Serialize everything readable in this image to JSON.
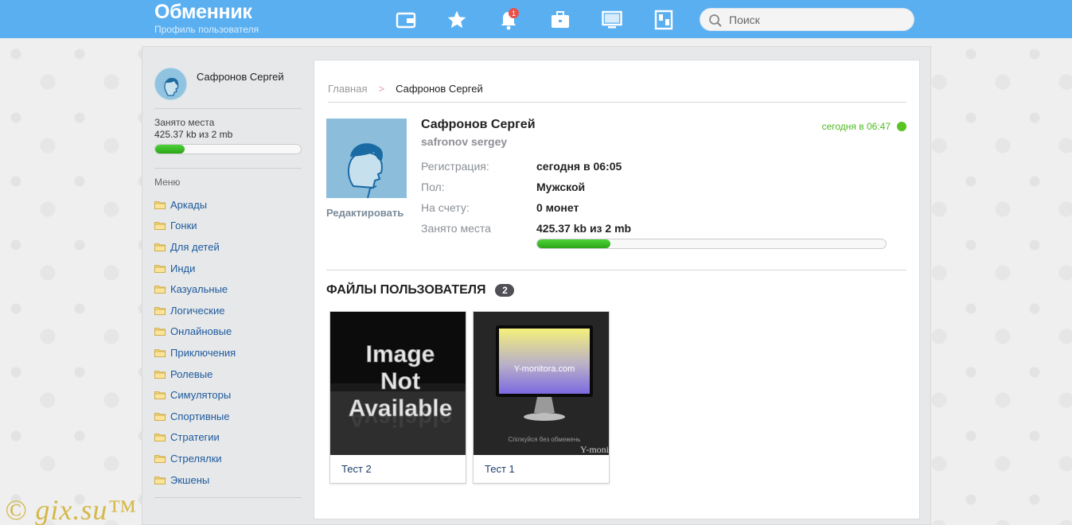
{
  "header": {
    "title": "Обменник",
    "subtitle": "Профиль пользователя",
    "nav_icons": [
      "wallet-icon",
      "star-icon",
      "bell-icon",
      "briefcase-icon",
      "monitor-icon",
      "device-icon"
    ],
    "notification_count": "1",
    "search_placeholder": "Поиск"
  },
  "sidebar": {
    "user_name": "Сафронов Сергей",
    "storage_label": "Занято места",
    "storage_value": "425.37 kb из 2 mb",
    "storage_fraction": 0.2,
    "menu_title": "Меню",
    "menu_items": [
      {
        "label": "Аркады"
      },
      {
        "label": "Гонки"
      },
      {
        "label": "Для детей"
      },
      {
        "label": "Инди"
      },
      {
        "label": "Казуальные"
      },
      {
        "label": "Логические"
      },
      {
        "label": "Онлайновые"
      },
      {
        "label": "Приключения"
      },
      {
        "label": "Ролевые"
      },
      {
        "label": "Симуляторы"
      },
      {
        "label": "Спортивные"
      },
      {
        "label": "Стратегии"
      },
      {
        "label": "Стрелялки"
      },
      {
        "label": "Экшены"
      }
    ]
  },
  "breadcrumb": {
    "home": "Главная",
    "separator": ">",
    "current": "Сафронов Сергей"
  },
  "profile": {
    "name": "Сафронов Сергей",
    "login": "safronov sergey",
    "edit_label": "Редактировать",
    "online_status": "сегодня в 06:47",
    "fields": [
      {
        "label": "Регистрация:",
        "value": "сегодня в 06:05"
      },
      {
        "label": "Пол:",
        "value": "Мужской"
      },
      {
        "label": "На счету:",
        "value": "0 монет"
      },
      {
        "label": "Занято места",
        "value": "425.37 kb из 2 mb"
      }
    ],
    "storage_fraction": 0.21
  },
  "files": {
    "title": "ФАЙЛЫ ПОЛЬЗОВАТЕЛЯ",
    "count": "2",
    "items": [
      {
        "name": "Тест 2",
        "thumb_text": [
          "Image",
          "Not",
          "Available"
        ]
      },
      {
        "name": "Тест 1",
        "thumb_caption": "Y-monitora.com",
        "thumb_footer": "Спілкуйся без обмежень",
        "thumb_corner": "Y-monito"
      }
    ]
  },
  "watermark": "© gix.su™",
  "colors": {
    "header_bg": "#5aaff0",
    "link": "#1e5a9c",
    "online": "#4ebb21",
    "progress": "#2ca516"
  }
}
